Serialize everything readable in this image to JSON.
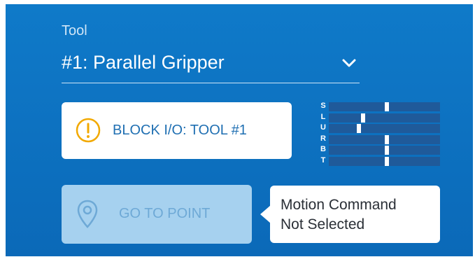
{
  "tool": {
    "label": "Tool",
    "selected": "#1: Parallel Gripper",
    "dropdown_icon": "chevron-down-icon"
  },
  "block_io": {
    "label": "BLOCK I/O: TOOL #1",
    "icon": "warning-icon",
    "icon_color": "#f2a900"
  },
  "axis_indicator": {
    "axes": [
      {
        "name": "S",
        "level": 0.52
      },
      {
        "name": "L",
        "level": 0.31
      },
      {
        "name": "U",
        "level": 0.27
      },
      {
        "name": "R",
        "level": 0.52
      },
      {
        "name": "B",
        "level": 0.52
      },
      {
        "name": "T",
        "level": 0.52
      }
    ]
  },
  "go_to_point": {
    "label": "GO TO POINT",
    "icon": "location-pin-icon",
    "state": "disabled"
  },
  "tooltip": {
    "line1": "Motion Command",
    "line2": "Not Selected"
  },
  "colors": {
    "panel": "#0f7ac9",
    "button_text": "#1f6fb2",
    "disabled_button": "#a6d1ef"
  }
}
